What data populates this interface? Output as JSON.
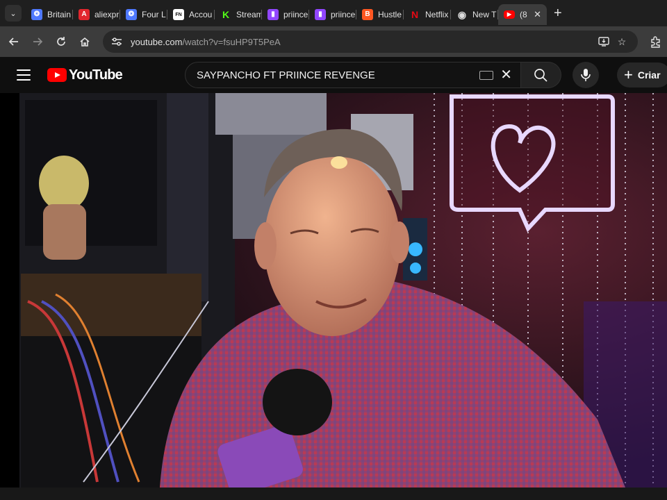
{
  "browser": {
    "tabs": [
      {
        "title": "Britain",
        "icon": "globe-badge-icon",
        "color": "#4f79ff",
        "glyph": "❂"
      },
      {
        "title": "aliexpr",
        "icon": "aliexpress-icon",
        "color": "#e1262d",
        "glyph": "A"
      },
      {
        "title": "Four L",
        "icon": "globe-badge-icon",
        "color": "#4f79ff",
        "glyph": "❂"
      },
      {
        "title": "Accou",
        "icon": "fn-icon",
        "color": "#ffffff",
        "glyph": "FN"
      },
      {
        "title": "Stream",
        "icon": "kick-icon",
        "color": "#53fc18",
        "glyph": "K"
      },
      {
        "title": "priince",
        "icon": "twitch-icon",
        "color": "#9146ff",
        "glyph": "▮"
      },
      {
        "title": "priince",
        "icon": "twitch-icon",
        "color": "#9146ff",
        "glyph": "▮"
      },
      {
        "title": "Hustle",
        "icon": "blogger-icon",
        "color": "#ff5722",
        "glyph": "B"
      },
      {
        "title": "Netflix",
        "icon": "netflix-icon",
        "color": "#e50914",
        "glyph": "N"
      },
      {
        "title": "New T",
        "icon": "chrome-icon",
        "color": "#dddddd",
        "glyph": "◉"
      },
      {
        "title": "(8",
        "icon": "youtube-icon",
        "color": "#ff0000",
        "glyph": "▶",
        "active": true
      }
    ],
    "address": {
      "host": "youtube.com",
      "path": "/watch?v=fsuHP9T5PeA"
    }
  },
  "youtube": {
    "logo_text": "YouTube",
    "search_query": "SAYPANCHO FT PRIINCE REVENGE",
    "create_label": "Criar"
  },
  "colors": {
    "tab_strip": "#1f1f1f",
    "toolbar": "#3c3c3c",
    "yt_background": "#0f0f0f",
    "yt_red": "#ff0000",
    "neon": "#e8d8ff"
  }
}
